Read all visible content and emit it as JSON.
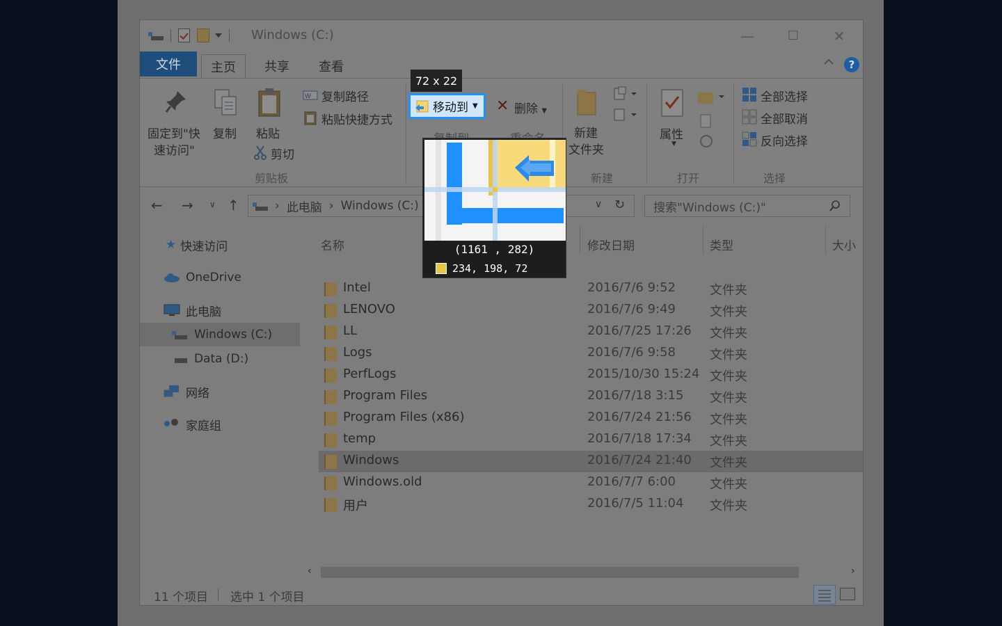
{
  "window": {
    "title": "Windows (C:)",
    "controls": {
      "minimize": "—",
      "maximize": "☐",
      "close": "✕"
    }
  },
  "tabs": {
    "file": "文件",
    "home": "主页",
    "share": "共享",
    "view": "查看"
  },
  "ribbon": {
    "clipboard": {
      "pin_line1": "固定到\"快",
      "pin_line2": "速访问\"",
      "copy": "复制",
      "paste": "粘贴",
      "copy_path": "复制路径",
      "paste_shortcut": "粘贴快捷方式",
      "cut": "剪切",
      "label": "剪贴板"
    },
    "organize": {
      "move_to": "移动到",
      "copy_to": "复制到",
      "delete": "删除",
      "rename": "重命名"
    },
    "new": {
      "new_folder_line1": "新建",
      "new_folder_line2": "文件夹",
      "label": "新建"
    },
    "open": {
      "properties": "属性",
      "label": "打开"
    },
    "select": {
      "select_all": "全部选择",
      "select_none": "全部取消",
      "invert": "反向选择",
      "label": "选择"
    }
  },
  "address": {
    "crumbs": [
      "此电脑",
      "Windows (C:)"
    ],
    "search_placeholder": "搜索\"Windows (C:)\""
  },
  "nav_pane": {
    "items": [
      {
        "label": "快速访问"
      },
      {
        "label": "OneDrive"
      },
      {
        "label": "此电脑"
      },
      {
        "label": "Windows (C:)",
        "selected": true
      },
      {
        "label": "Data (D:)"
      },
      {
        "label": "网络"
      },
      {
        "label": "家庭组"
      }
    ]
  },
  "columns": {
    "name": "名称",
    "date": "修改日期",
    "type": "类型",
    "size": "大小"
  },
  "files": [
    {
      "name": "Intel",
      "date": "2016/7/6 9:52",
      "type": "文件夹"
    },
    {
      "name": "LENOVO",
      "date": "2016/7/6 9:49",
      "type": "文件夹"
    },
    {
      "name": "LL",
      "date": "2016/7/25 17:26",
      "type": "文件夹"
    },
    {
      "name": "Logs",
      "date": "2016/7/6 9:58",
      "type": "文件夹"
    },
    {
      "name": "PerfLogs",
      "date": "2015/10/30 15:24",
      "type": "文件夹"
    },
    {
      "name": "Program Files",
      "date": "2016/7/18 3:15",
      "type": "文件夹"
    },
    {
      "name": "Program Files (x86)",
      "date": "2016/7/24 21:56",
      "type": "文件夹"
    },
    {
      "name": "temp",
      "date": "2016/7/18 17:34",
      "type": "文件夹"
    },
    {
      "name": "Windows",
      "date": "2016/7/24 21:40",
      "type": "文件夹",
      "selected": true
    },
    {
      "name": "Windows.old",
      "date": "2016/7/7 6:00",
      "type": "文件夹"
    },
    {
      "name": "用户",
      "date": "2016/7/5 11:04",
      "type": "文件夹"
    }
  ],
  "status": {
    "count": "11 个项目",
    "selected": "选中 1 个项目"
  },
  "capture": {
    "size_label": "72 x 22",
    "coords": "(1161 , 282)",
    "rgb": "234, 198,  72",
    "swatch_color": "#eac648"
  },
  "colors": {
    "accent": "#1e90ff",
    "file_tab": "#1e4d7c",
    "folder": "#eac648"
  }
}
